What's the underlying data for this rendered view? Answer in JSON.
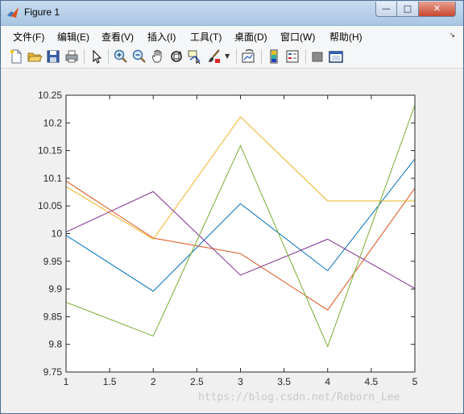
{
  "window": {
    "title": "Figure 1",
    "minimize_icon": "minimize-icon",
    "maximize_icon": "maximize-icon",
    "close_icon": "close-icon"
  },
  "menubar": {
    "items": [
      {
        "label": "文件(F)"
      },
      {
        "label": "编辑(E)"
      },
      {
        "label": "查看(V)"
      },
      {
        "label": "插入(I)"
      },
      {
        "label": "工具(T)"
      },
      {
        "label": "桌面(D)"
      },
      {
        "label": "窗口(W)"
      },
      {
        "label": "帮助(H)"
      }
    ]
  },
  "toolbar": {
    "buttons": [
      {
        "icon": "new-figure-icon"
      },
      {
        "icon": "open-file-icon"
      },
      {
        "icon": "save-icon"
      },
      {
        "icon": "print-icon"
      },
      {
        "icon": "edit-plot-arrow-icon"
      },
      {
        "icon": "zoom-in-icon"
      },
      {
        "icon": "zoom-out-icon"
      },
      {
        "icon": "pan-hand-icon"
      },
      {
        "icon": "rotate-3d-icon"
      },
      {
        "icon": "data-cursor-icon"
      },
      {
        "icon": "brush-icon"
      },
      {
        "icon": "link-plot-icon"
      },
      {
        "icon": "colorbar-icon"
      },
      {
        "icon": "legend-icon"
      },
      {
        "icon": "hide-plot-tools-icon"
      },
      {
        "icon": "show-plot-tools-icon"
      }
    ]
  },
  "chart_data": {
    "type": "line",
    "title": "",
    "xlabel": "",
    "ylabel": "",
    "x": [
      1,
      2,
      3,
      4,
      5
    ],
    "xlim": [
      1,
      5
    ],
    "ylim": [
      9.75,
      10.25
    ],
    "xticks": [
      "1",
      "1.5",
      "2",
      "2.5",
      "3",
      "3.5",
      "4",
      "4.5",
      "5"
    ],
    "yticks": [
      "9.75",
      "9.8",
      "9.85",
      "9.9",
      "9.95",
      "10",
      "10.05",
      "10.1",
      "10.15",
      "10.2",
      "10.25"
    ],
    "grid": false,
    "series": [
      {
        "color": "#0072bd",
        "values": [
          9.997,
          9.896,
          10.054,
          9.933,
          10.135
        ]
      },
      {
        "color": "#d95319",
        "values": [
          10.095,
          9.992,
          9.964,
          9.862,
          10.082
        ]
      },
      {
        "color": "#edb120",
        "values": [
          10.085,
          9.99,
          10.211,
          10.059,
          10.059
        ]
      },
      {
        "color": "#7e2f8e",
        "values": [
          10.003,
          10.076,
          9.925,
          9.99,
          9.901
        ]
      },
      {
        "color": "#77ac30",
        "values": [
          9.876,
          9.815,
          10.159,
          9.796,
          10.232
        ]
      }
    ]
  },
  "watermark": "https://blog.csdn.net/Reborn_Lee"
}
